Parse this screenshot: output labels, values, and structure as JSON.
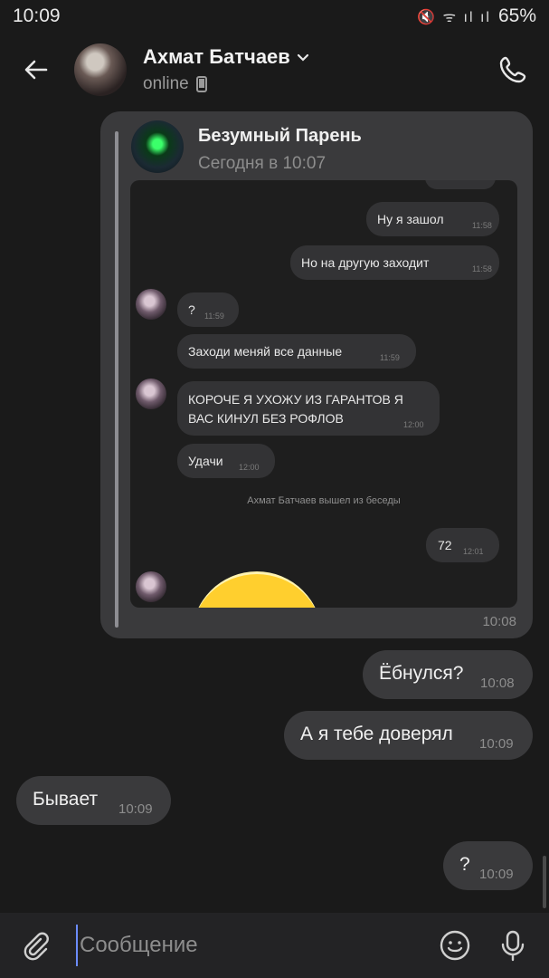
{
  "status_bar": {
    "time": "10:09",
    "battery": "65%",
    "icons": "🔇 ᯤ ıl ıl"
  },
  "header": {
    "contact_name": "Ахмат Батчаев",
    "status": "online"
  },
  "forwarded": {
    "author": "Безумный Парень",
    "date": "Сегодня в 10:07",
    "time": "10:08",
    "screenshot": {
      "messages": [
        {
          "text": "Ну я зашол",
          "time": "11:58"
        },
        {
          "text": "Но на другую заходит",
          "time": "11:58"
        },
        {
          "text": "?",
          "time": "11:59"
        },
        {
          "text": "Заходи меняй все данные",
          "time": "11:59"
        },
        {
          "text": "КОРОЧЕ Я УХОЖУ ИЗ ГАРАНТОВ Я",
          "text2": "ВАС КИНУЛ БЕЗ РОФЛОВ",
          "time": "12:00"
        },
        {
          "text": "Удачи",
          "time": "12:00"
        },
        {
          "text": "72",
          "time": "12:01"
        }
      ],
      "system_note": "Ахмат Батчаев вышел из беседы"
    }
  },
  "messages": [
    {
      "text": "Ёбнулся?",
      "time": "10:08"
    },
    {
      "text": "А я тебе доверял",
      "time": "10:09"
    },
    {
      "text": "Бывает",
      "time": "10:09"
    },
    {
      "text": "?",
      "time": "10:09"
    }
  ],
  "composer": {
    "placeholder": "Сообщение"
  },
  "colors": {
    "background": "#1a1a1a",
    "bubble": "#3a3a3c",
    "accent_caret": "#6b8cff"
  }
}
